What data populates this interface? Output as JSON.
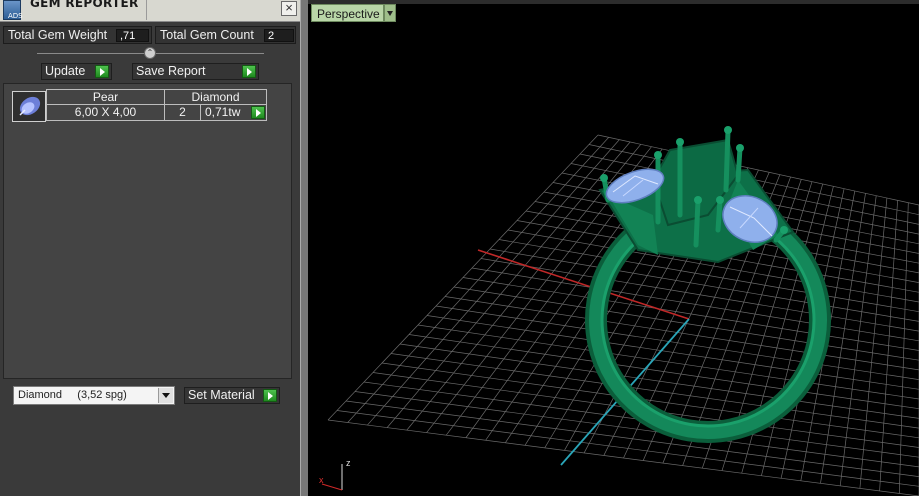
{
  "panel": {
    "title": "GEM REPORTER",
    "icon": "gem-reporter-icon",
    "close_icon": "close-icon",
    "total_weight_label": "Total Gem Weight",
    "total_weight_value": ",71",
    "total_count_label": "Total Gem Count",
    "total_count_value": "2",
    "update_label": "Update",
    "save_report_label": "Save Report",
    "gem_row": {
      "shape": "Pear",
      "type": "Diamond",
      "size": "6,00 X 4,00",
      "count": "2",
      "weight": "0,71tw"
    },
    "material_select": "Diamond     (3,52 spg)",
    "set_material_label": "Set Material"
  },
  "viewport": {
    "view_mode": "Perspective",
    "axis_z": "z",
    "axis_x": "x",
    "model_color": "#0e7a4e",
    "gem_color": "#9fc4ff"
  }
}
